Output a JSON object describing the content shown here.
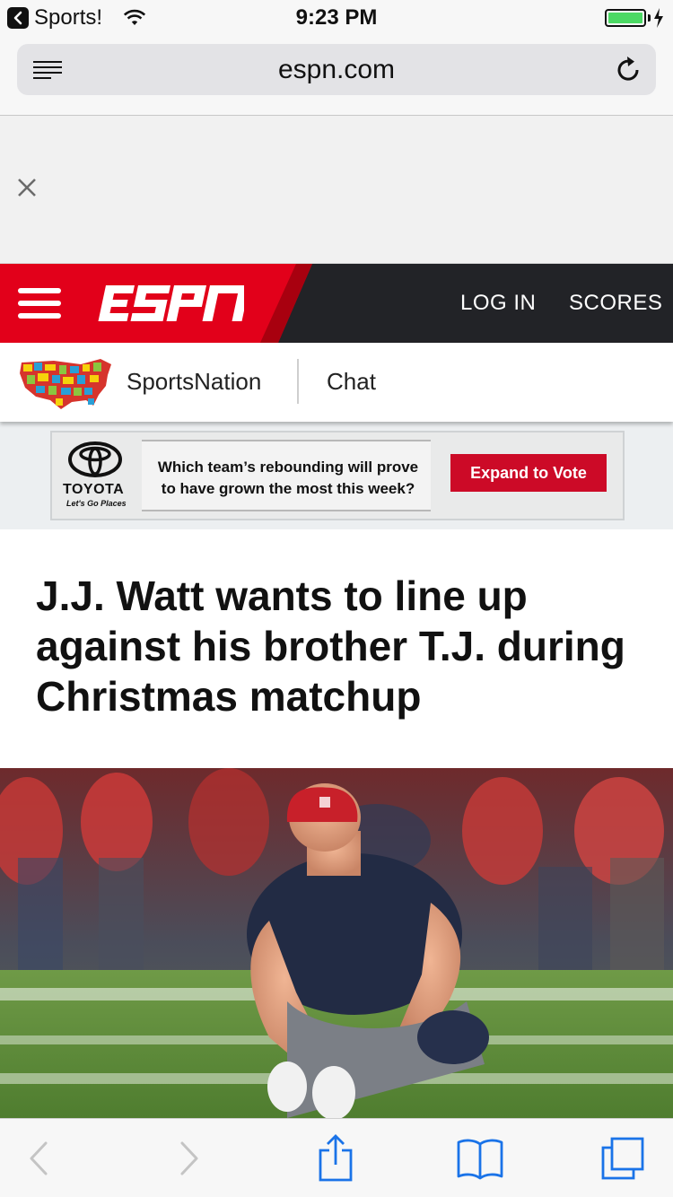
{
  "status_bar": {
    "back_app": "Sports!",
    "time": "9:23 PM",
    "battery_color": "#4cd964"
  },
  "browser": {
    "url": "espn.com",
    "icons": [
      "reader-icon",
      "reload-icon"
    ]
  },
  "ad": {
    "close_icon": "close-icon"
  },
  "header": {
    "brand_color": "#cc0a27",
    "login": "LOG IN",
    "scores": "SCORES"
  },
  "subnav": {
    "sportsnation": "SportsNation",
    "chat": "Chat"
  },
  "poll": {
    "sponsor": "TOYOTA",
    "sponsor_tagline": "Let's Go Places",
    "question": "Which team’s rebounding will prove to have grown the most this week?",
    "button_label": "Expand to Vote",
    "button_color": "#cc0a27"
  },
  "article": {
    "headline": "J.J. Watt wants to line up against his brother T.J. during Christmas matchup"
  },
  "toolbar": {
    "icons": [
      "back-icon",
      "forward-icon",
      "share-icon",
      "bookmarks-icon",
      "tabs-icon"
    ]
  }
}
